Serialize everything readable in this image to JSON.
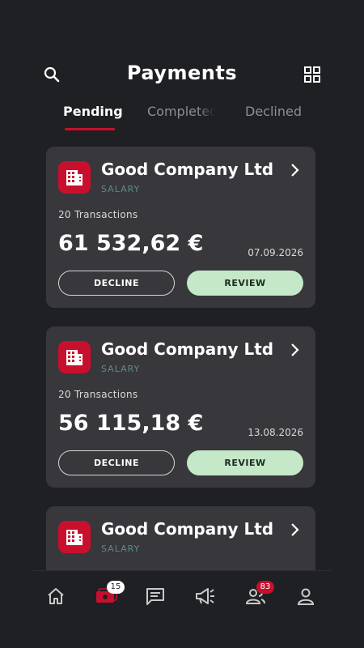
{
  "header": {
    "title": "Payments",
    "search_icon": "search-icon",
    "grid_icon": "grid-icon"
  },
  "tabs": [
    {
      "label": "Pending",
      "active": true
    },
    {
      "label": "Completed",
      "active": false
    },
    {
      "label": "Declined",
      "active": false
    }
  ],
  "payments": [
    {
      "company": "Good Company Ltd",
      "category": "SALARY",
      "transactions": "20 Transactions",
      "amount": "61 532,62 €",
      "date": "07.09.2026",
      "decline_label": "DECLINE",
      "review_label": "REVIEW"
    },
    {
      "company": "Good Company Ltd",
      "category": "SALARY",
      "transactions": "20 Transactions",
      "amount": "56 115,18 €",
      "date": "13.08.2026",
      "decline_label": "DECLINE",
      "review_label": "REVIEW"
    },
    {
      "company": "Good Company Ltd",
      "category": "SALARY"
    }
  ],
  "bottom_nav": {
    "items": [
      {
        "icon": "home-icon"
      },
      {
        "icon": "payments-icon",
        "badge": "15",
        "active": true
      },
      {
        "icon": "chat-icon"
      },
      {
        "icon": "megaphone-icon"
      },
      {
        "icon": "users-icon",
        "badge": "83"
      },
      {
        "icon": "profile-icon"
      }
    ]
  },
  "colors": {
    "background": "#1f2023",
    "card": "#38373b",
    "accent": "#c8102e",
    "review": "#c5e8c8",
    "category": "#5e8c84"
  }
}
